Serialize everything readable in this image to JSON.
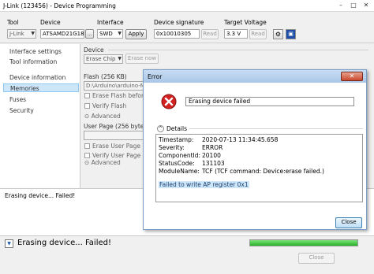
{
  "window": {
    "title": "J-Link (123456) - Device Programming",
    "controls": [
      "–",
      "□",
      "✕"
    ]
  },
  "toolbar": {
    "tool_label": "Tool",
    "tool_value": "J-Link",
    "device_label": "Device",
    "device_value": "ATSAMD21G18A",
    "device_browse": "...",
    "interface_label": "Interface",
    "interface_value": "SWD",
    "apply_label": "Apply",
    "signature_label": "Device signature",
    "signature_value": "0x10010305",
    "signature_read": "Read",
    "voltage_label": "Target Voltage",
    "voltage_value": "3.3 V",
    "voltage_read": "Read",
    "icons": [
      "gear-icon",
      "save-icon"
    ]
  },
  "nav": {
    "items": [
      {
        "label": "Interface settings",
        "selected": false
      },
      {
        "label": "Tool information",
        "selected": false
      },
      {
        "label": "Device information",
        "selected": false
      },
      {
        "label": "Memories",
        "selected": true
      },
      {
        "label": "Fuses",
        "selected": false
      },
      {
        "label": "Security",
        "selected": false
      }
    ]
  },
  "panel": {
    "device_section": "Device",
    "erase_chip": "Erase Chip",
    "erase_now": "Erase now",
    "flash_section": "Flash (256 KB)",
    "flash_path": "D:\\Arduino\\arduino-MO",
    "flash_browse": "...",
    "erase_flash_cb": "Erase Flash before pro",
    "verify_flash_cb": "Verify Flash",
    "advanced_1": "Advanced",
    "user_page_section": "User Page (256 bytes)",
    "erase_user_cb": "Erase User Page before",
    "verify_user_cb": "Verify User Page",
    "advanced_2": "Advanced"
  },
  "log": {
    "lines": [
      "Erasing device... Failed!"
    ]
  },
  "status": {
    "message": "Erasing device... Failed!",
    "progress": 1.0,
    "progress_color": "#26b526",
    "close_label": "Close"
  },
  "dialog": {
    "title": "Error",
    "message": "Erasing device failed",
    "details_label": "Details",
    "details": [
      {
        "key": "Timestamp:",
        "value": "2020-07-13 11:34:45.658"
      },
      {
        "key": "Severity:",
        "value": "ERROR"
      },
      {
        "key": "ComponentId:",
        "value": "20100"
      },
      {
        "key": "StatusCode:",
        "value": "131103"
      },
      {
        "key": "ModuleName:",
        "value": "TCF (TCF command: Device:erase failed.)"
      }
    ],
    "highlight": "Failed to write AP register 0x1",
    "close_label": "Close",
    "icon": "error-icon"
  }
}
